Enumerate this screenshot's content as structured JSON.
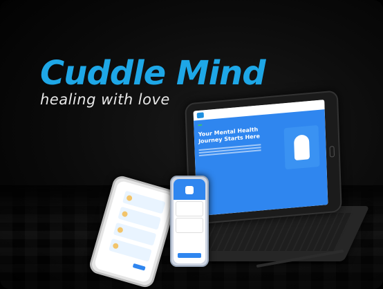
{
  "brand": {
    "name": "Cuddle Mind",
    "tagline": "healing with love"
  },
  "tablet": {
    "badge": "",
    "hero_title": "Your Mental Health Journey Starts Here"
  },
  "colors": {
    "accent": "#1ea7e7",
    "hero_blue": "#2f86ef",
    "background": "#000000"
  }
}
